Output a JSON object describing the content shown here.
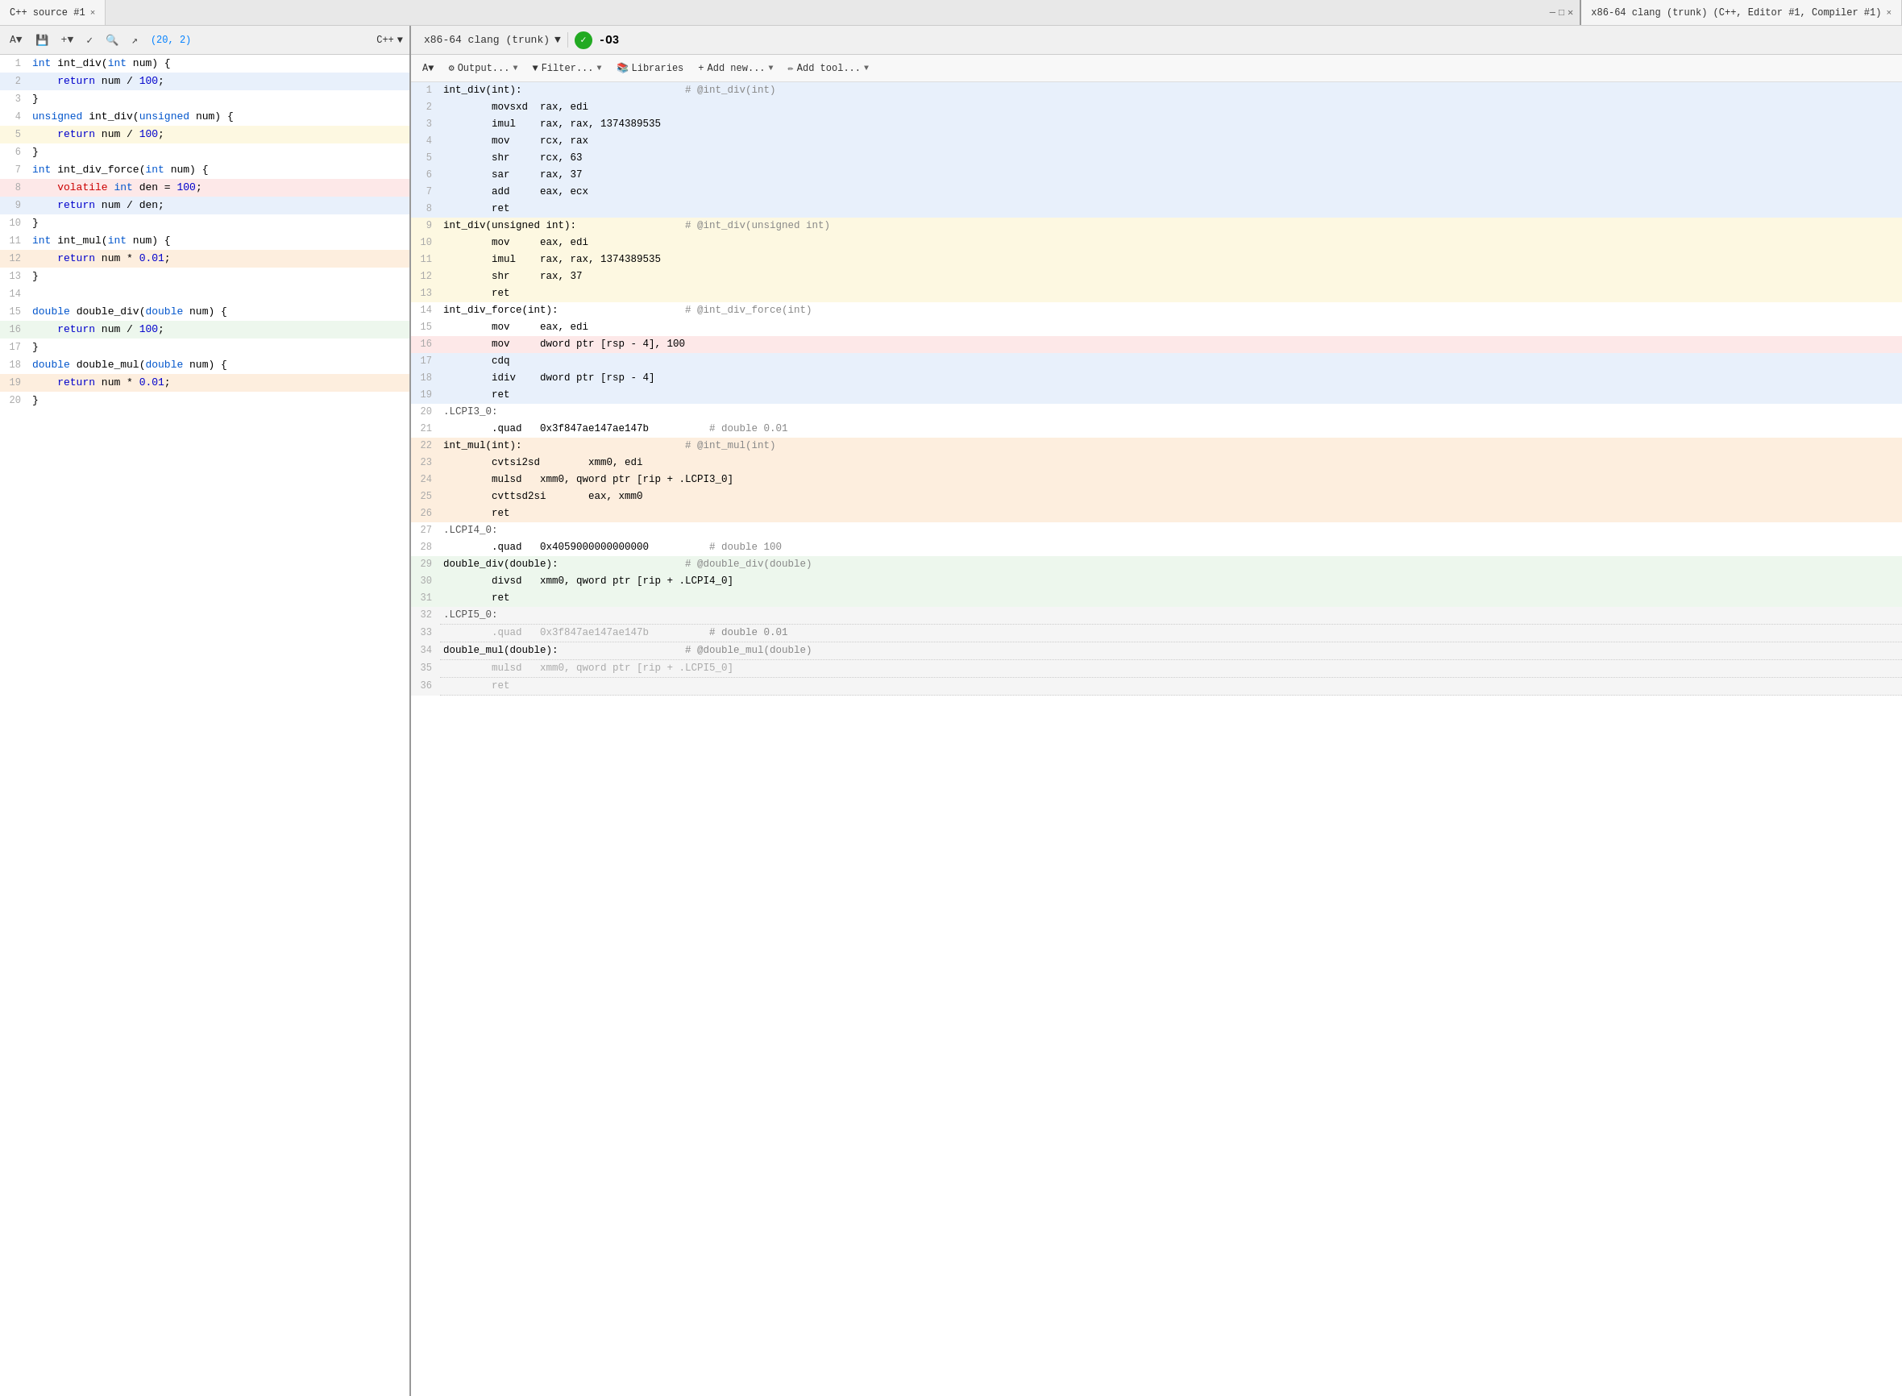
{
  "tabs": {
    "left": {
      "label": "C++ source #1",
      "close": "×",
      "window_controls": [
        "—",
        "□",
        "×"
      ]
    },
    "right": {
      "label": "x86-64 clang (trunk) (C++, Editor #1, Compiler #1)",
      "close": "×"
    }
  },
  "left_toolbar": {
    "cursor_pos": "(20, 2)",
    "language": "C++",
    "buttons": [
      "A▼",
      "💾",
      "+▼",
      "∨",
      "🔍",
      "↗"
    ]
  },
  "right_toolbar": {
    "compiler": "x86-64 clang (trunk)",
    "opt_flag": "-O3",
    "status": "✓"
  },
  "right_secondary": {
    "font_btn": "A▼",
    "output_btn": "⚙ Output...",
    "filter_btn": "▼ Filter...",
    "libraries_btn": "📚 Libraries",
    "add_new_btn": "+ Add new...",
    "add_tool_btn": "✏ Add tool..."
  },
  "left_code": [
    {
      "num": 1,
      "text": "int int_div(int num) {",
      "bg": ""
    },
    {
      "num": 2,
      "text": "    return num / 100;",
      "bg": "bg-blue-light"
    },
    {
      "num": 3,
      "text": "}",
      "bg": ""
    },
    {
      "num": 4,
      "text": "unsigned int_div(unsigned num) {",
      "bg": ""
    },
    {
      "num": 5,
      "text": "    return num / 100;",
      "bg": "bg-yellow-light"
    },
    {
      "num": 6,
      "text": "}",
      "bg": ""
    },
    {
      "num": 7,
      "text": "int int_div_force(int num) {",
      "bg": ""
    },
    {
      "num": 8,
      "text": "    volatile int den = 100;",
      "bg": "bg-red-light"
    },
    {
      "num": 9,
      "text": "    return num / den;",
      "bg": "bg-blue-light"
    },
    {
      "num": 10,
      "text": "}",
      "bg": ""
    },
    {
      "num": 11,
      "text": "int int_mul(int num) {",
      "bg": ""
    },
    {
      "num": 12,
      "text": "    return num * 0.01;",
      "bg": "bg-orange-light"
    },
    {
      "num": 13,
      "text": "}",
      "bg": ""
    },
    {
      "num": 14,
      "text": "",
      "bg": ""
    },
    {
      "num": 15,
      "text": "double double_div(double num) {",
      "bg": ""
    },
    {
      "num": 16,
      "text": "    return num / 100;",
      "bg": "bg-green-light"
    },
    {
      "num": 17,
      "text": "}",
      "bg": ""
    },
    {
      "num": 18,
      "text": "double double_mul(double num) {",
      "bg": ""
    },
    {
      "num": 19,
      "text": "    return num * 0.01;",
      "bg": "bg-orange-light"
    },
    {
      "num": 20,
      "text": "}",
      "bg": ""
    }
  ],
  "right_asm": [
    {
      "num": 1,
      "text": "int_div(int):                           # @int_div(int)",
      "bg": "asm-bg-blue"
    },
    {
      "num": 2,
      "text": "        movsxd  rax, edi",
      "bg": "asm-bg-blue"
    },
    {
      "num": 3,
      "text": "        imul    rax, rax, 1374389535",
      "bg": "asm-bg-blue"
    },
    {
      "num": 4,
      "text": "        mov     rcx, rax",
      "bg": "asm-bg-blue"
    },
    {
      "num": 5,
      "text": "        shr     rcx, 63",
      "bg": "asm-bg-blue"
    },
    {
      "num": 6,
      "text": "        sar     rax, 37",
      "bg": "asm-bg-blue"
    },
    {
      "num": 7,
      "text": "        add     eax, ecx",
      "bg": "asm-bg-blue"
    },
    {
      "num": 8,
      "text": "        ret",
      "bg": "asm-bg-blue"
    },
    {
      "num": 9,
      "text": "int_div(unsigned int):                  # @int_div(unsigned int)",
      "bg": "asm-bg-yellow"
    },
    {
      "num": 10,
      "text": "        mov     eax, edi",
      "bg": "asm-bg-yellow"
    },
    {
      "num": 11,
      "text": "        imul    rax, rax, 1374389535",
      "bg": "asm-bg-yellow"
    },
    {
      "num": 12,
      "text": "        shr     rax, 37",
      "bg": "asm-bg-yellow"
    },
    {
      "num": 13,
      "text": "        ret",
      "bg": "asm-bg-yellow"
    },
    {
      "num": 14,
      "text": "int_div_force(int):                     # @int_div_force(int)",
      "bg": ""
    },
    {
      "num": 15,
      "text": "        mov     eax, edi",
      "bg": ""
    },
    {
      "num": 16,
      "text": "        mov     dword ptr [rsp - 4], 100",
      "bg": "asm-bg-red"
    },
    {
      "num": 17,
      "text": "        cdq",
      "bg": "asm-bg-blue"
    },
    {
      "num": 18,
      "text": "        idiv    dword ptr [rsp - 4]",
      "bg": "asm-bg-blue"
    },
    {
      "num": 19,
      "text": "        ret",
      "bg": "asm-bg-blue"
    },
    {
      "num": 20,
      "text": ".LCPI3_0:",
      "bg": ""
    },
    {
      "num": 21,
      "text": "        .quad   0x3f847ae147ae147b          # double 0.01",
      "bg": ""
    },
    {
      "num": 22,
      "text": "int_mul(int):                           # @int_mul(int)",
      "bg": "asm-bg-orange"
    },
    {
      "num": 23,
      "text": "        cvtsi2sd        xmm0, edi",
      "bg": "asm-bg-orange"
    },
    {
      "num": 24,
      "text": "        mulsd   xmm0, qword ptr [rip + .LCPI3_0]",
      "bg": "asm-bg-orange"
    },
    {
      "num": 25,
      "text": "        cvttsd2si       eax, xmm0",
      "bg": "asm-bg-orange"
    },
    {
      "num": 26,
      "text": "        ret",
      "bg": "asm-bg-orange"
    },
    {
      "num": 27,
      "text": ".LCPI4_0:",
      "bg": ""
    },
    {
      "num": 28,
      "text": "        .quad   0x4059000000000000          # double 100",
      "bg": ""
    },
    {
      "num": 29,
      "text": "double_div(double):                     # @double_div(double)",
      "bg": "asm-bg-green"
    },
    {
      "num": 30,
      "text": "        divsd   xmm0, qword ptr [rip + .LCPI4_0]",
      "bg": "asm-bg-green"
    },
    {
      "num": 31,
      "text": "        ret",
      "bg": "asm-bg-green"
    },
    {
      "num": 32,
      "text": ".LCPI5_0:",
      "bg": "asm-bg-gray"
    },
    {
      "num": 33,
      "text": "        .quad   0x3f847ae147ae147b          # double 0.01",
      "bg": "asm-bg-gray"
    },
    {
      "num": 34,
      "text": "double_mul(double):                     # @double_mul(double)",
      "bg": "asm-bg-gray"
    },
    {
      "num": 35,
      "text": "        mulsd   xmm0, qword ptr [rip + .LCPI5_0]",
      "bg": "asm-bg-gray"
    },
    {
      "num": 36,
      "text": "        ret",
      "bg": "asm-bg-gray"
    }
  ]
}
